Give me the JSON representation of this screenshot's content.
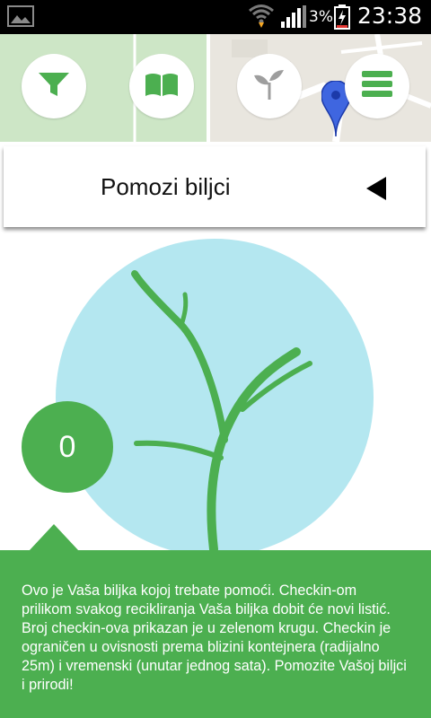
{
  "status_bar": {
    "battery_percent": "3%",
    "time": "23:38"
  },
  "map_toolbar": {
    "buttons": [
      {
        "icon": "filter-icon"
      },
      {
        "icon": "book-icon"
      },
      {
        "icon": "plant-icon"
      },
      {
        "icon": "menu-icon"
      }
    ],
    "marker": "map-pin-icon"
  },
  "header": {
    "title": "Pomozi biljci",
    "back_icon": "back-arrow-icon"
  },
  "plant": {
    "checkin_count": "0"
  },
  "info": {
    "text": "Ovo je Vaša biljka kojoj trebate pomoći. Checkin-om prilikom svakog recikliranja Vaša biljka dobit će novi listić. Broj checkin-ova prikazan je u zelenom krugu. Checkin je ograničen u ovisnosti prema blizini kontejnera (radijalno 25m) i vremenski (unutar jednog sata). Pomozite Vašoj biljci i prirodi!"
  },
  "colors": {
    "accent_green": "#4caf50",
    "circle_blue": "#b4e7f0",
    "status_bar": "#000000"
  }
}
